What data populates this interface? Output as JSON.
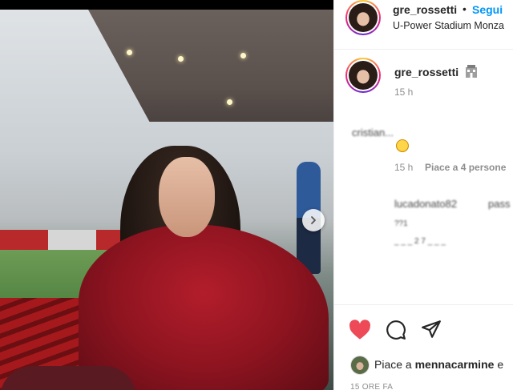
{
  "post": {
    "photo_alt": "",
    "has_next": true
  },
  "header": {
    "username": "gre_rossetti",
    "separator": "•",
    "follow_label": "Segui",
    "location": "U-Power Stadium Monza"
  },
  "caption": {
    "username": "gre_rossetti",
    "time": "15 h"
  },
  "comments": [
    {
      "username_blurred": "cristian...",
      "time": "15 h",
      "likes": "Piace a 4 persone"
    },
    {
      "username_blurred": "lucadonato82",
      "text_blurred": "pass",
      "line2_blurred": "??1",
      "line3_blurred": "_ _ _ 2 7 _ _ _"
    }
  ],
  "likes": {
    "prefix": "Piace a",
    "user": "mennacarmine",
    "suffix": "e"
  },
  "footer": {
    "time_label": "15 ORE FA"
  },
  "colors": {
    "accent": "#0095f6",
    "like": "#ed4956",
    "text": "#262626",
    "muted": "#8e8e8e"
  },
  "icons": [
    "chevron-right-icon",
    "heart-icon",
    "comment-icon",
    "share-icon",
    "building-icon",
    "emoji-face-icon"
  ]
}
